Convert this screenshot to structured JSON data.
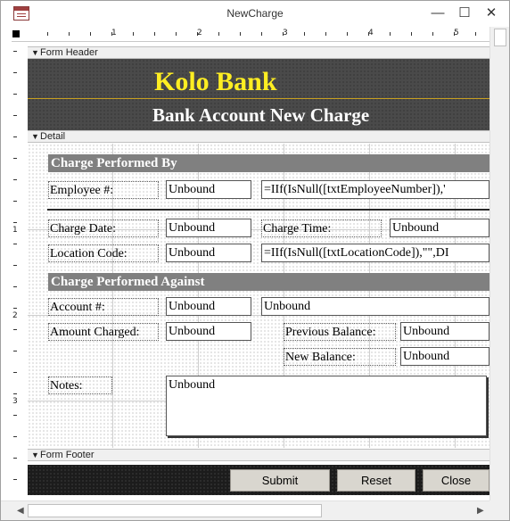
{
  "window": {
    "title": "NewCharge",
    "minimize": "—",
    "maximize": "☐",
    "close": "✕"
  },
  "ruler": {
    "h_labels": [
      "1",
      "2",
      "3",
      "4",
      "5"
    ],
    "v_labels": [
      "1",
      "2",
      "3"
    ]
  },
  "sections": {
    "form_header": "Form Header",
    "detail": "Detail",
    "form_footer": "Form Footer"
  },
  "header": {
    "brand": "Kolo Bank",
    "subtitle": "Bank Account New Charge",
    "brand_color": "#ffee22"
  },
  "detail": {
    "band_performed_by": "Charge Performed By",
    "employee_label": "Employee #:",
    "employee_value": "Unbound",
    "employee_expr": "=IIf(IsNull([txtEmployeeNumber]),'",
    "charge_date_label": "Charge Date:",
    "charge_date_value": "Unbound",
    "charge_time_label": "Charge Time:",
    "charge_time_value": "Unbound",
    "location_label": "Location Code:",
    "location_value": "Unbound",
    "location_expr": "=IIf(IsNull([txtLocationCode]),\"\",DI",
    "band_performed_against": "Charge Performed Against",
    "account_label": "Account #:",
    "account_value": "Unbound",
    "account_name_value": "Unbound",
    "amount_label": "Amount Charged:",
    "amount_value": "Unbound",
    "prev_balance_label": "Previous Balance:",
    "prev_balance_value": "Unbound",
    "new_balance_label": "New Balance:",
    "new_balance_value": "Unbound",
    "notes_label": "Notes:",
    "notes_value": "Unbound"
  },
  "footer": {
    "submit": "Submit",
    "reset": "Reset",
    "close": "Close"
  }
}
